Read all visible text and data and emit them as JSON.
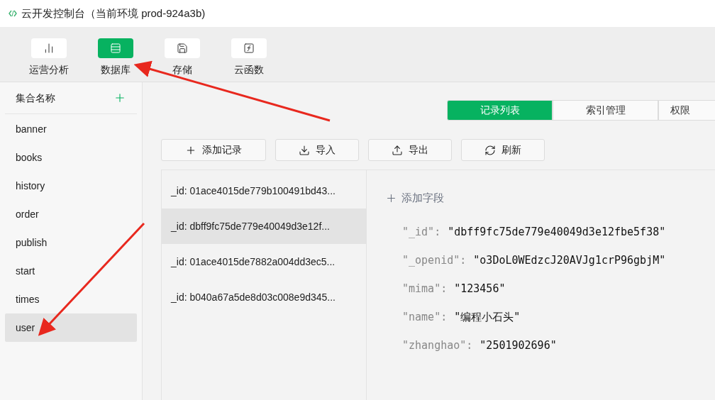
{
  "window": {
    "title": "云开发控制台（当前环境 prod-924a3b)"
  },
  "toolbar": [
    {
      "label": "运营分析",
      "kind": "chart",
      "selected": false
    },
    {
      "label": "数据库",
      "kind": "database",
      "selected": true
    },
    {
      "label": "存储",
      "kind": "save",
      "selected": false
    },
    {
      "label": "云函数",
      "kind": "function",
      "selected": false
    }
  ],
  "sidebar": {
    "heading": "集合名称",
    "items": [
      {
        "label": "banner",
        "selected": false
      },
      {
        "label": "books",
        "selected": false
      },
      {
        "label": "history",
        "selected": false
      },
      {
        "label": "order",
        "selected": false
      },
      {
        "label": "publish",
        "selected": false
      },
      {
        "label": "start",
        "selected": false
      },
      {
        "label": "times",
        "selected": false
      },
      {
        "label": "user",
        "selected": true
      }
    ]
  },
  "tabs": [
    {
      "label": "记录列表",
      "selected": true
    },
    {
      "label": "索引管理",
      "selected": false
    },
    {
      "label": "权限",
      "selected": false
    }
  ],
  "actions": [
    {
      "label": "添加记录",
      "kind": "plus"
    },
    {
      "label": "导入",
      "kind": "download"
    },
    {
      "label": "导出",
      "kind": "upload"
    },
    {
      "label": "刷新",
      "kind": "refresh"
    }
  ],
  "records": [
    {
      "label": "_id: 01ace4015de779b100491bd43...",
      "selected": false
    },
    {
      "label": "_id: dbff9fc75de779e40049d3e12f...",
      "selected": true
    },
    {
      "label": "_id: 01ace4015de7882a004dd3ec5...",
      "selected": false
    },
    {
      "label": "_id: b040a67a5de8d03c008e9d345...",
      "selected": false
    }
  ],
  "detail": {
    "add_field": "添加字段",
    "fields": [
      {
        "key": "\"_id\":",
        "value": "\"dbff9fc75de779e40049d3e12fbe5f38\""
      },
      {
        "key": "\"_openid\":",
        "value": "\"o3DoL0WEdzcJ20AVJg1crP96gbjM\""
      },
      {
        "key": "\"mima\":",
        "value": "\"123456\""
      },
      {
        "key": "\"name\":",
        "value": "\"编程小石头\""
      },
      {
        "key": "\"zhanghao\":",
        "value": "\"2501902696\""
      }
    ]
  },
  "annotations": [
    {
      "kind": "arrow"
    },
    {
      "kind": "arrow"
    }
  ]
}
